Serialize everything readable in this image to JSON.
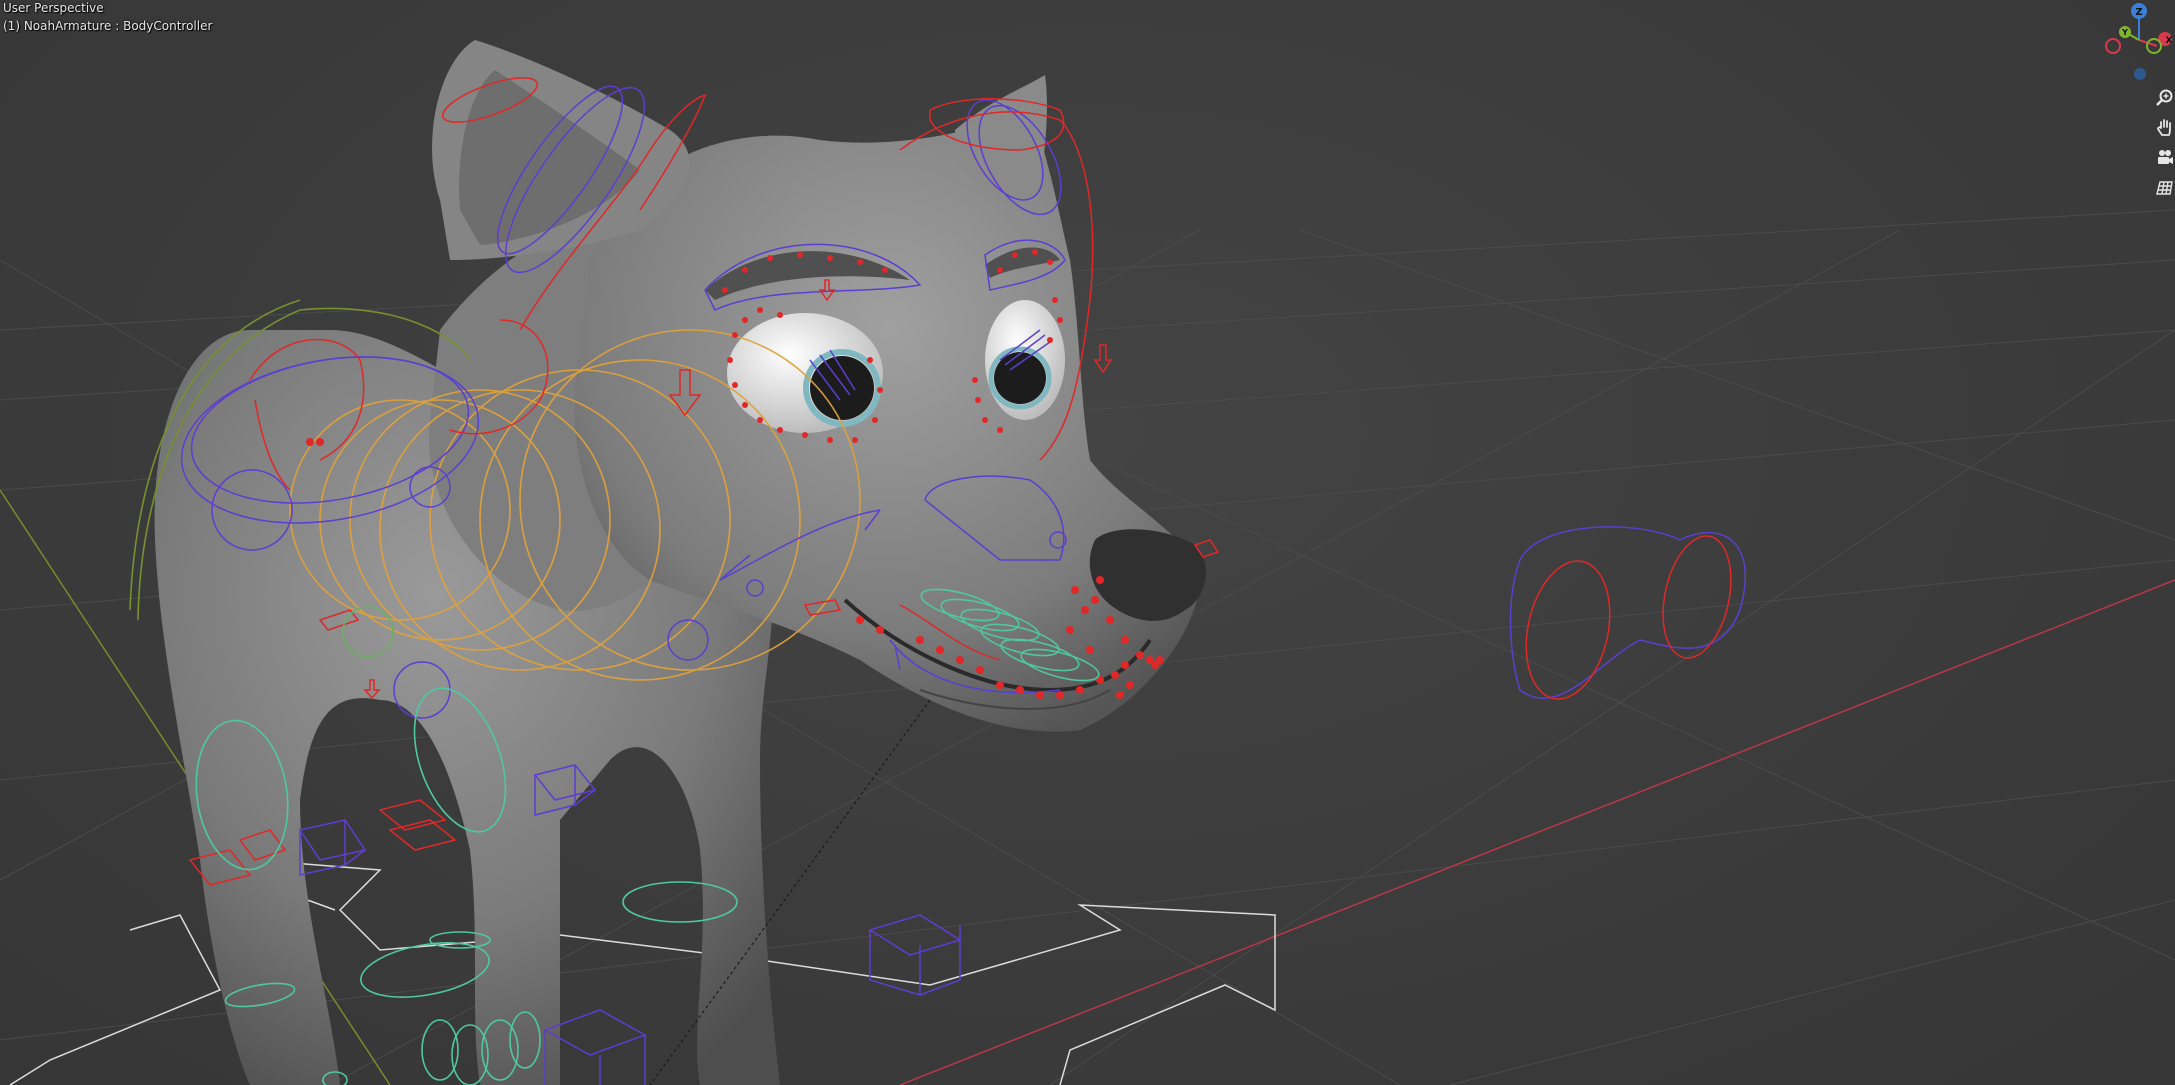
{
  "viewport": {
    "view_label": "User Perspective",
    "object_label": "(1) NoahArmature : BodyController"
  },
  "gizmo": {
    "axis_z": "Z",
    "axis_y": "Y",
    "axis_x": "X",
    "colors": {
      "x": "#d93b4d",
      "y": "#7fb52e",
      "z": "#3a7fd8",
      "neg": "#2c5a8f"
    }
  },
  "nav_buttons": [
    {
      "icon": "zoom-icon"
    },
    {
      "icon": "pan-hand-icon"
    },
    {
      "icon": "camera-icon"
    },
    {
      "icon": "ortho-grid-icon"
    }
  ],
  "colors": {
    "grid": "#4a4a4a",
    "x_axis": "#c0394a",
    "y_axis": "#7a8f2a",
    "mesh": "#8a8a8a",
    "bone_red": "#e02828",
    "bone_blue": "#5a3fd0",
    "bone_orange": "#e0a030",
    "bone_teal": "#4fc8a0",
    "bone_white": "#e0e0e0"
  }
}
